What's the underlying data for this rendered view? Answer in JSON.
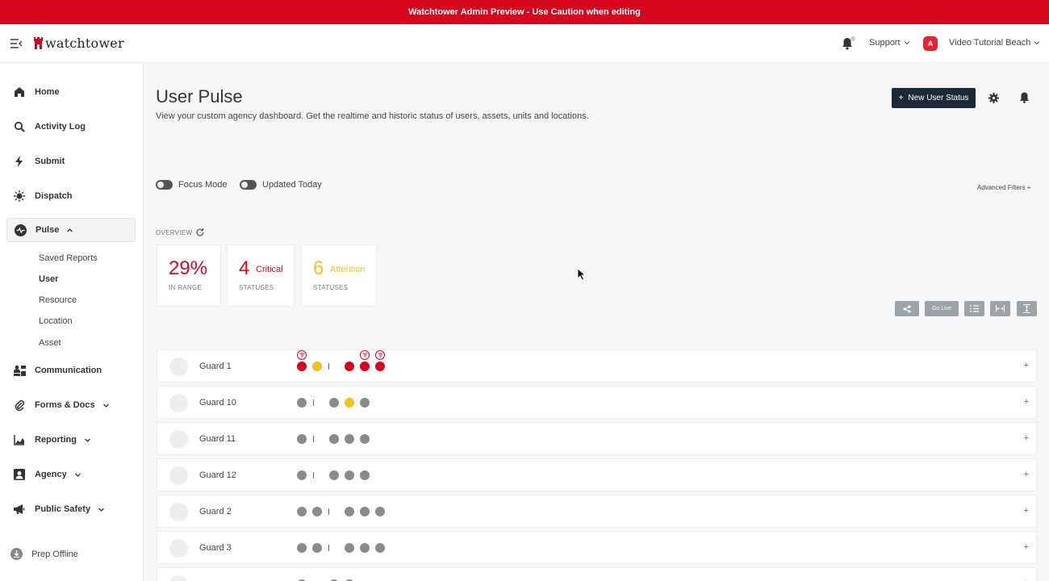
{
  "banner": {
    "text": "Watchtower Admin Preview - Use Caution when editing"
  },
  "topbar": {
    "logo_text": "watchtower",
    "support_label": "Support",
    "account_initial": "A",
    "account_label": "Video Tutorial Beach"
  },
  "sidebar": {
    "items": [
      {
        "label": "Home",
        "icon": "home-icon"
      },
      {
        "label": "Activity Log",
        "icon": "search-icon"
      },
      {
        "label": "Submit",
        "icon": "lightning-icon"
      },
      {
        "label": "Dispatch",
        "icon": "siren-icon"
      },
      {
        "label": "Pulse",
        "icon": "pulse-icon"
      },
      {
        "label": "Communication",
        "icon": "people-icon"
      },
      {
        "label": "Forms & Docs",
        "icon": "paperclip-icon"
      },
      {
        "label": "Reporting",
        "icon": "chart-icon"
      },
      {
        "label": "Agency",
        "icon": "id-badge-icon"
      },
      {
        "label": "Public Safety",
        "icon": "megaphone-icon"
      }
    ],
    "pulse_sub": [
      "Saved Reports",
      "User",
      "Resource",
      "Location",
      "Asset"
    ],
    "prep_offline": "Prep Offline"
  },
  "page": {
    "title": "User Pulse",
    "subtitle": "View your custom agency dashboard. Get the realtime and historic status of users, assets, units and locations.",
    "new_button": "New User Status",
    "new_button_icon": "+"
  },
  "filters": {
    "focus_mode": "Focus Mode",
    "updated_today": "Updated Today",
    "advanced": "Advanced Filters +"
  },
  "overview": {
    "label": "OVERVIEW",
    "in_range_value": "29%",
    "in_range_caption": "IN RANGE",
    "critical_count": "4",
    "critical_word": "Critical",
    "critical_caption": "STATUSES",
    "attention_count": "6",
    "attention_word": "Attention",
    "attention_caption": "STATUSES"
  },
  "toolbar": {
    "go_live": "Go Live"
  },
  "colors": {
    "critical": "#d6061c",
    "attention": "#f5c01a",
    "neutral": "#8a8a8a",
    "brand_dark": "#1b2a38"
  },
  "rows": [
    {
      "name": "Guard 1",
      "before": [
        "critical",
        "attention"
      ],
      "after": [
        "critical",
        "critical",
        "critical"
      ],
      "flags": [
        0,
        3,
        4
      ]
    },
    {
      "name": "Guard 10",
      "before": [
        "neutral"
      ],
      "after": [
        "neutral",
        "attention",
        "neutral"
      ],
      "flags": []
    },
    {
      "name": "Guard 11",
      "before": [
        "neutral"
      ],
      "after": [
        "neutral",
        "neutral",
        "neutral"
      ],
      "flags": []
    },
    {
      "name": "Guard 12",
      "before": [
        "neutral"
      ],
      "after": [
        "neutral",
        "neutral",
        "neutral"
      ],
      "flags": []
    },
    {
      "name": "Guard 2",
      "before": [
        "neutral",
        "neutral"
      ],
      "after": [
        "neutral",
        "neutral",
        "neutral"
      ],
      "flags": []
    },
    {
      "name": "Guard 3",
      "before": [
        "neutral",
        "neutral"
      ],
      "after": [
        "neutral",
        "neutral",
        "neutral"
      ],
      "flags": []
    },
    {
      "name": "",
      "before": [
        "neutral"
      ],
      "after": [
        "neutral",
        "neutral"
      ],
      "flags": []
    }
  ],
  "row_expand_label": "+"
}
